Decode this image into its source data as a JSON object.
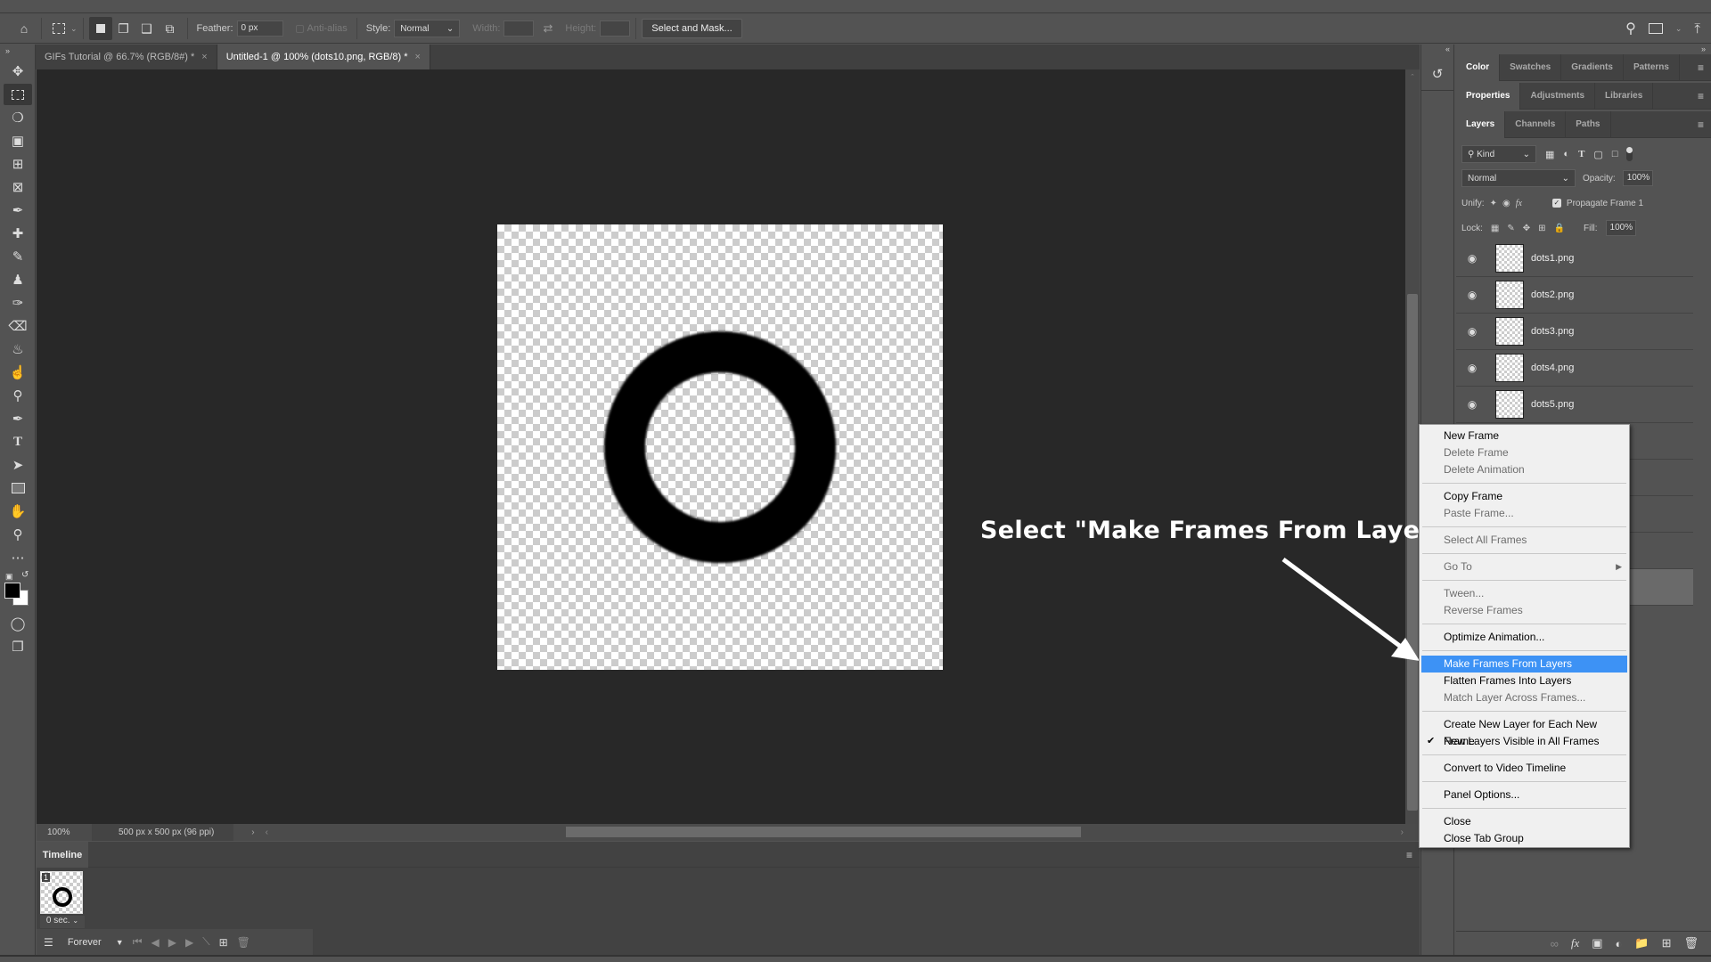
{
  "options_bar": {
    "feather_label": "Feather:",
    "feather_value": "0 px",
    "antialias_label": "Anti-alias",
    "style_label": "Style:",
    "style_value": "Normal",
    "width_label": "Width:",
    "height_label": "Height:",
    "select_mask_label": "Select and Mask..."
  },
  "doc_tabs": [
    {
      "label": "GIFs Tutorial @ 66.7% (RGB/8#) *",
      "active": false
    },
    {
      "label": "Untitled-1 @ 100% (dots10.png, RGB/8) *",
      "active": true
    }
  ],
  "annotation": "Select \"Make Frames From Layers\"",
  "status": {
    "zoom": "100%",
    "doc_info": "500 px x 500 px (96 ppi)"
  },
  "timeline": {
    "tab_label": "Timeline",
    "frame_number": "1",
    "frame_delay": "0 sec.",
    "loop_value": "Forever"
  },
  "panels": {
    "group1_tabs": [
      "Color",
      "Swatches",
      "Gradients",
      "Patterns"
    ],
    "group2_tabs": [
      "Properties",
      "Adjustments",
      "Libraries"
    ],
    "group3_tabs": [
      "Layers",
      "Channels",
      "Paths"
    ],
    "filter_kind": "Kind",
    "blend_mode": "Normal",
    "opacity_label": "Opacity:",
    "opacity_value": "100%",
    "unify_label": "Unify:",
    "propagate_label": "Propagate Frame 1",
    "lock_label": "Lock:",
    "fill_label": "Fill:",
    "fill_value": "100%"
  },
  "layers": [
    {
      "name": "dots1.png"
    },
    {
      "name": "dots2.png"
    },
    {
      "name": "dots3.png"
    },
    {
      "name": "dots4.png"
    },
    {
      "name": "dots5.png"
    }
  ],
  "context_menu": {
    "items": [
      {
        "label": "New Frame",
        "enabled": true
      },
      {
        "label": "Delete Frame",
        "enabled": false
      },
      {
        "label": "Delete Animation",
        "enabled": false
      },
      {
        "sep": true
      },
      {
        "label": "Copy Frame",
        "enabled": true
      },
      {
        "label": "Paste Frame...",
        "enabled": false
      },
      {
        "sep": true
      },
      {
        "label": "Select All Frames",
        "enabled": false
      },
      {
        "sep": true
      },
      {
        "label": "Go To",
        "enabled": false,
        "submenu": true
      },
      {
        "sep": true
      },
      {
        "label": "Tween...",
        "enabled": false
      },
      {
        "label": "Reverse Frames",
        "enabled": false
      },
      {
        "sep": true
      },
      {
        "label": "Optimize Animation...",
        "enabled": true
      },
      {
        "sep": true
      },
      {
        "label": "Make Frames From Layers",
        "enabled": true,
        "highlighted": true
      },
      {
        "label": "Flatten Frames Into Layers",
        "enabled": true
      },
      {
        "label": "Match Layer Across Frames...",
        "enabled": false
      },
      {
        "sep": true
      },
      {
        "label": "Create New Layer for Each New Frame",
        "enabled": true
      },
      {
        "label": "New Layers Visible in All Frames",
        "enabled": true,
        "checked": true
      },
      {
        "sep": true
      },
      {
        "label": "Convert to Video Timeline",
        "enabled": true
      },
      {
        "sep": true
      },
      {
        "label": "Panel Options...",
        "enabled": true
      },
      {
        "sep": true
      },
      {
        "label": "Close",
        "enabled": true
      },
      {
        "label": "Close Tab Group",
        "enabled": true
      }
    ]
  },
  "colors": {
    "highlight": "#3d92f5",
    "canvas_bg": "#282828",
    "ui_bg": "#535353"
  }
}
